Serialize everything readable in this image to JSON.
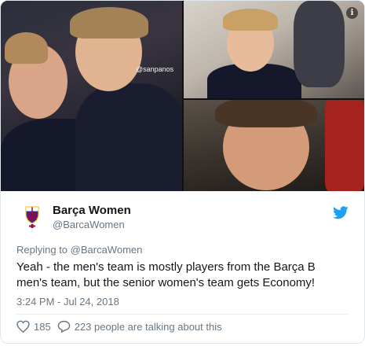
{
  "media": {
    "watermark": "@sanpanos",
    "info_glyph": "i"
  },
  "author": {
    "display_name": "Barça Women",
    "handle": "@BarcaWomen"
  },
  "reply_to": "Replying to @BarcaWomen",
  "tweet_text": "Yeah - the men's team is mostly players from the Barça B men's team, but the senior women's team gets Economy!",
  "timestamp": "3:24 PM - Jul 24, 2018",
  "actions": {
    "likes": "185",
    "talking": "223 people are talking about this"
  },
  "colors": {
    "twitter_blue": "#1da1f2",
    "text_dark": "#14171a",
    "text_gray": "#657786",
    "barca_blue": "#1b3a8a",
    "barca_red": "#a50044",
    "barca_yellow": "#f2c230"
  },
  "icons": [
    "info-icon",
    "twitter-bird-icon",
    "heart-icon",
    "reply-bubble-icon",
    "barca-crest-icon"
  ]
}
